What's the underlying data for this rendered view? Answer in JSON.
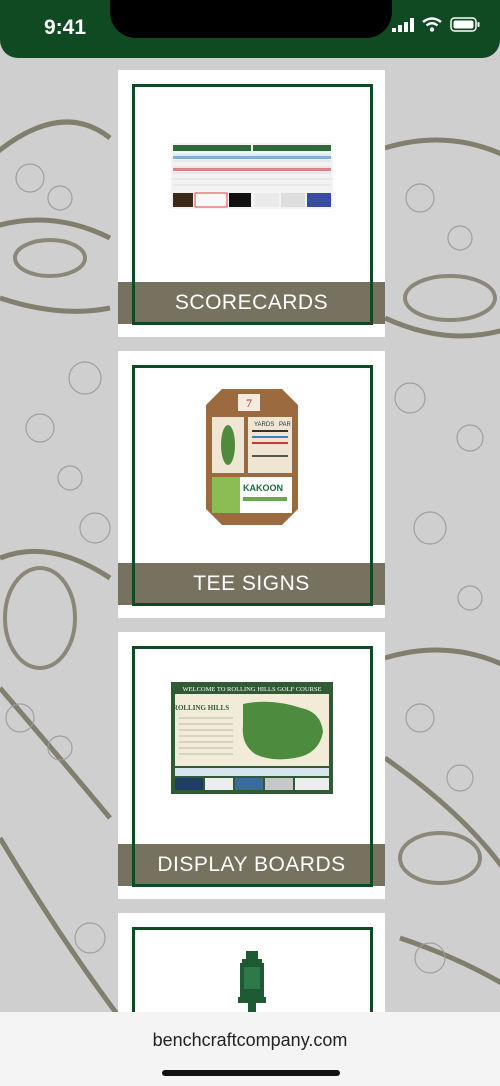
{
  "status": {
    "time": "9:41"
  },
  "cards": [
    {
      "label": "SCORECARDS"
    },
    {
      "label": "TEE SIGNS",
      "sign_number": "7",
      "yards_header": "YARDS",
      "par_header": "PAR",
      "sponsor": "KAKOON"
    },
    {
      "label": "DISPLAY BOARDS",
      "board_title": "WELCOME TO ROLLING HILLS GOLF COURSE",
      "board_logo": "ROLLING HILLS"
    },
    {
      "label": ""
    }
  ],
  "browser": {
    "url": "benchcraftcompany.com"
  },
  "colors": {
    "primary": "#0f4a22",
    "label_bg": "#77715f",
    "background": "#cfcfcf"
  },
  "icons": [
    "signal-icon",
    "wifi-icon",
    "battery-icon"
  ]
}
